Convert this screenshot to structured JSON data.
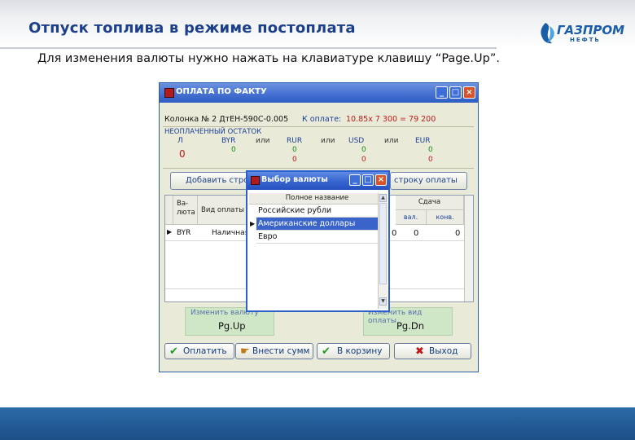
{
  "slide": {
    "title": "Отпуск топлива в режиме постоплата",
    "subtitle": "Для изменения валюты нужно нажать на клавиатуре клавишу “Page.Up”.",
    "logo_text": "ГАЗПРОМ",
    "logo_sub": "НЕФТЬ"
  },
  "dialog": {
    "title": "ОПЛАТА ПО ФАКТУ",
    "column_info": "Колонка № 2 ДтЕН-590С-0.005",
    "to_pay_label": "К оплате:",
    "to_pay_value": "10.85х  7 300 =   79 200",
    "unpaid_label": "НЕОПЛАЧЕННЫЙ ОСТАТОК",
    "currencies": [
      {
        "code": "Л",
        "value1": "0",
        "value2": ""
      },
      {
        "code": "BYR",
        "value1": "0",
        "value2": ""
      },
      {
        "code": "RUR",
        "value1": "0",
        "value2": "0"
      },
      {
        "code": "USD",
        "value1": "0",
        "value2": "0"
      },
      {
        "code": "EUR",
        "value1": "0",
        "value2": "0"
      }
    ],
    "or_label": "или",
    "add_row_button": "Добавить стро",
    "delete_row_button": "строку оплаты",
    "grid": {
      "col_currency": "Ва-\nлюта",
      "col_payment_type": "Вид оплаты",
      "col_change": "Сдача",
      "col_change_cur": "вал.",
      "col_change_conv": "конв.",
      "row": {
        "currency": "BYR",
        "payment_type": "Наличная",
        "v1": "0",
        "v2": "0",
        "v3": "0"
      }
    },
    "change_currency_label": "Изменить валюту",
    "change_currency_key": "Pg.Up",
    "change_payment_label": "Изменить вид оплаты",
    "change_payment_key": "Pg.Dn",
    "buttons": {
      "pay": "Оплатить",
      "enter_sum": "Внести сумм",
      "to_basket": "В корзину",
      "exit": "Выход"
    }
  },
  "popup": {
    "title": "Выбор валюты",
    "header": "Полное название",
    "items": [
      "Российские рубли",
      "Американские доллары",
      "Евро"
    ],
    "selected_index": 1
  },
  "colors": {
    "title_blue": "#1c3f8c",
    "titlebar_blue": "#3a66cf",
    "dialog_bg": "#e9ead7",
    "amount_red": "#c01818",
    "currency_code_blue": "#1b3f9c",
    "pg_panel_green": "#cfe6c7",
    "footer_blue": "#1f5590"
  }
}
